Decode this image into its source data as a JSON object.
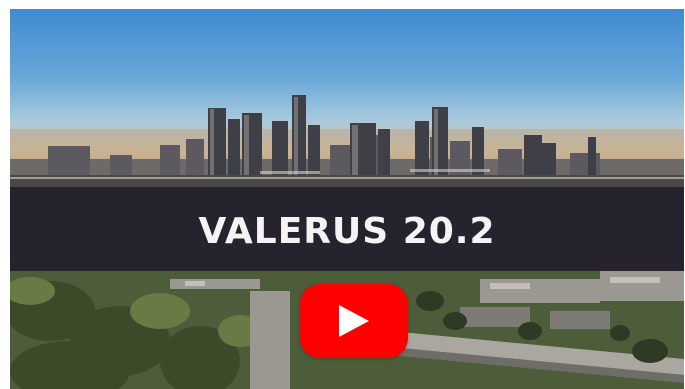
{
  "video": {
    "title": "VALERUS 20.2"
  },
  "player": {
    "play_icon": "play-icon",
    "play_color": "#ff0000"
  },
  "colors": {
    "title_band": "#27232e",
    "title_text": "#f4f4f4",
    "sky_top": "#3f8bd0"
  }
}
